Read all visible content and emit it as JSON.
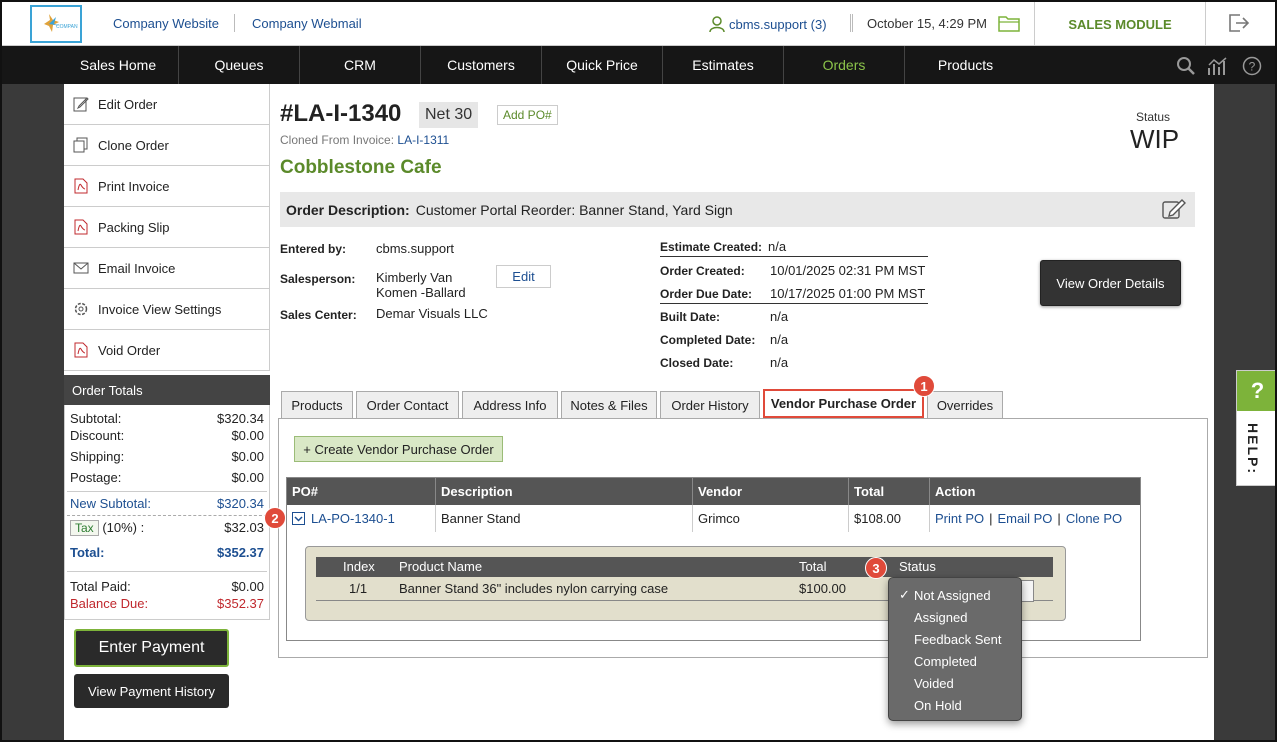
{
  "header": {
    "links": [
      "Company Website",
      "Company Webmail"
    ],
    "user": "cbms.support (3)",
    "datetime": "October 15, 4:29 PM",
    "module": "SALES MODULE"
  },
  "nav": {
    "items": [
      "Sales Home",
      "Queues",
      "CRM",
      "Customers",
      "Quick Price",
      "Estimates",
      "Orders",
      "Products"
    ],
    "active": "Orders"
  },
  "sidebar": {
    "actions": [
      "Edit Order",
      "Clone Order",
      "Print Invoice",
      "Packing Slip",
      "Email Invoice",
      "Invoice View Settings",
      "Void Order"
    ],
    "totals_title": "Order Totals",
    "totals": {
      "subtotal_label": "Subtotal:",
      "subtotal": "$320.34",
      "discount_label": "Discount:",
      "discount": "$0.00",
      "shipping_label": "Shipping:",
      "shipping": "$0.00",
      "postage_label": "Postage:",
      "postage": "$0.00",
      "new_subtotal_label": "New Subtotal:",
      "new_subtotal": "$320.34",
      "tax_label": "Tax",
      "tax_rate": "(10%) :",
      "tax": "$32.03",
      "total_label": "Total:",
      "total": "$352.37",
      "paid_label": "Total Paid:",
      "paid": "$0.00",
      "balance_label": "Balance Due:",
      "balance": "$352.37"
    },
    "enter_payment": "Enter Payment",
    "view_payment_history": "View Payment History"
  },
  "order": {
    "number": "#LA-I-1340",
    "terms": "Net 30",
    "add_po": "Add PO#",
    "cloned_prefix": "Cloned From Invoice:",
    "cloned_from": "LA-I-1311",
    "customer": "Cobblestone Cafe",
    "status_label": "Status",
    "status": "WIP",
    "description_label": "Order Description:",
    "description": "Customer Portal Reorder: Banner Stand, Yard Sign",
    "entered_by_label": "Entered by:",
    "entered_by": "cbms.support",
    "salesperson_label": "Salesperson:",
    "salesperson_1": "Kimberly Van",
    "salesperson_2": "Komen -Ballard",
    "edit_label": "Edit",
    "sales_center_label": "Sales Center:",
    "sales_center": "Demar Visuals LLC",
    "estimate_created_label": "Estimate Created:",
    "estimate_created": "n/a",
    "order_created_label": "Order Created:",
    "order_created": "10/01/2025 02:31 PM MST",
    "order_due_label": "Order Due Date:",
    "order_due": "10/17/2025 01:00 PM MST",
    "built_label": "Built Date:",
    "built": "n/a",
    "completed_label": "Completed Date:",
    "completed": "n/a",
    "closed_label": "Closed Date:",
    "closed": "n/a",
    "view_details": "View Order Details"
  },
  "tabs": [
    "Products",
    "Order Contact",
    "Address Info",
    "Notes & Files",
    "Order History",
    "Vendor Purchase Order",
    "Overrides"
  ],
  "active_tab": "Vendor Purchase Order",
  "vpo": {
    "create_label": "+ Create Vendor Purchase Order",
    "columns": [
      "PO#",
      "Description",
      "Vendor",
      "Total",
      "Action"
    ],
    "row": {
      "po": "LA-PO-1340-1",
      "description": "Banner Stand",
      "vendor": "Grimco",
      "total": "$108.00"
    },
    "actions": [
      "Print PO",
      "Email PO",
      "Clone PO"
    ],
    "action_sep": "|",
    "sub_columns": [
      "Index",
      "Product Name",
      "Total",
      "Status"
    ],
    "sub_row": {
      "index": "1/1",
      "product": "Banner Stand 36\" includes nylon carrying case",
      "total": "$100.00"
    }
  },
  "status_dropdown": {
    "options": [
      "Not Assigned",
      "Assigned",
      "Feedback Sent",
      "Completed",
      "Voided",
      "On Hold"
    ],
    "selected": "Not Assigned",
    "check": "✓"
  },
  "markers": [
    "1",
    "2",
    "3"
  ],
  "help": {
    "q": "?",
    "label": "HELP:"
  },
  "colors": {
    "accent_green": "#7db33a",
    "link_blue": "#1d4f91",
    "marker_red": "#e04a3a"
  }
}
